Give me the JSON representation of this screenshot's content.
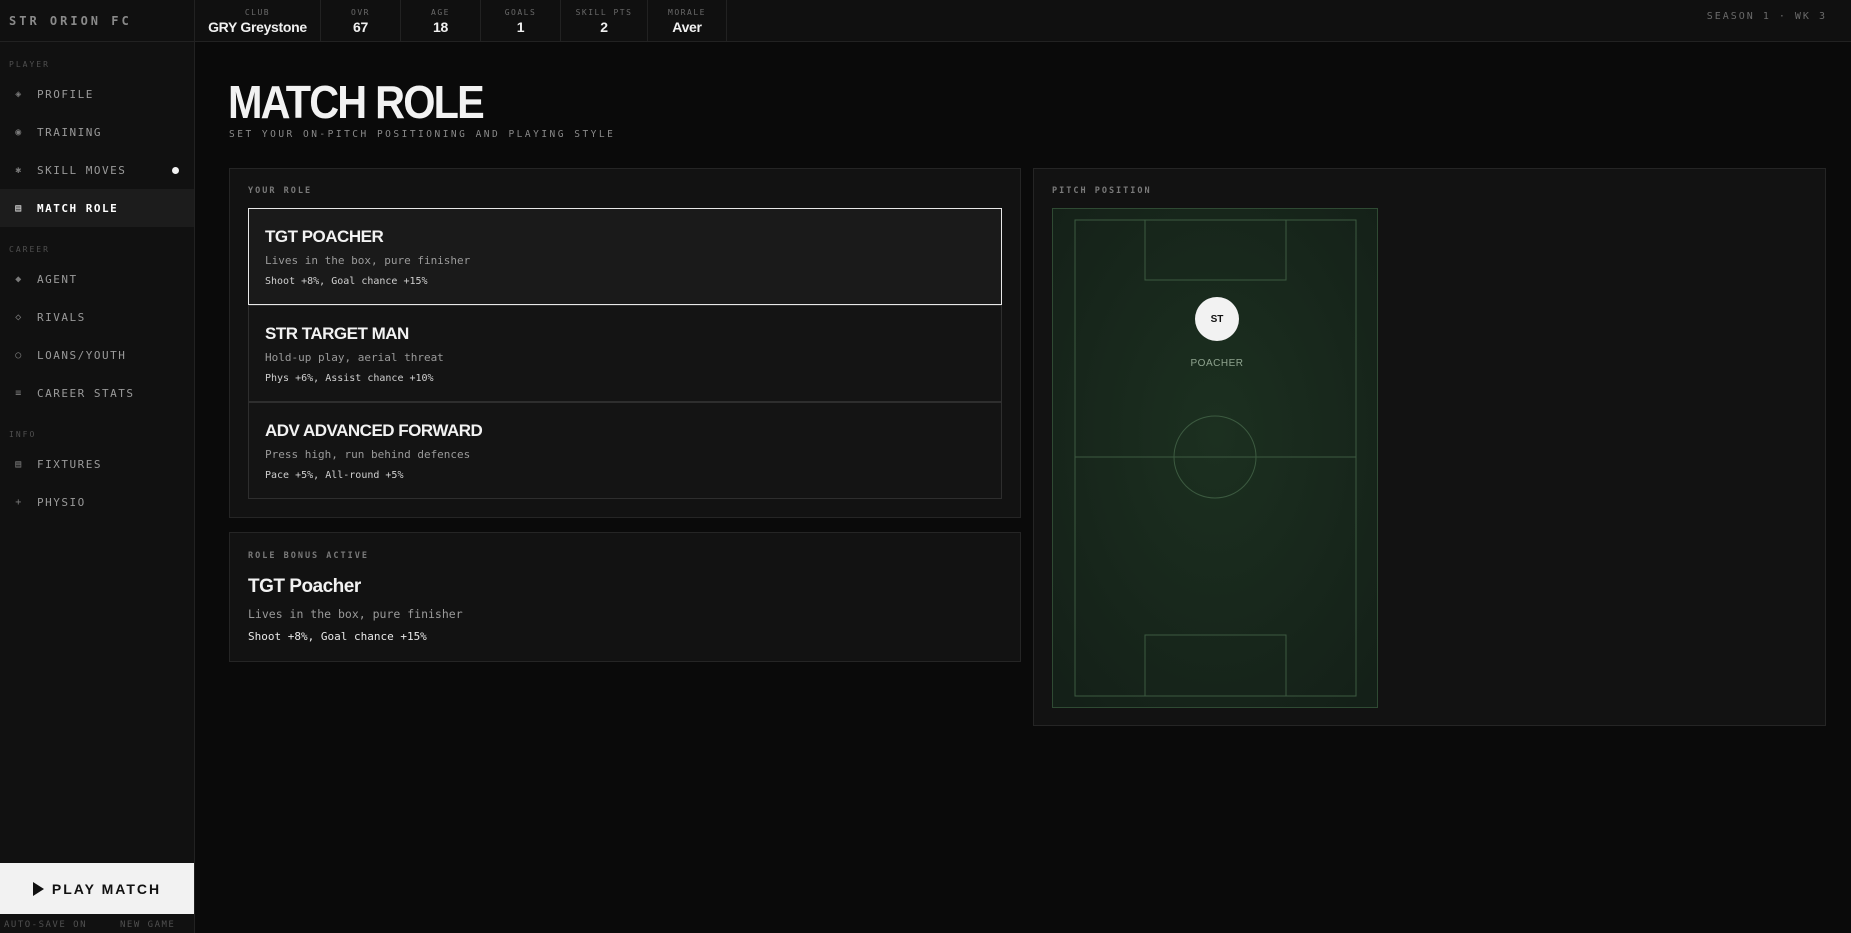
{
  "brand": "STR ORION FC",
  "season": "SEASON 1 · WK 3",
  "stats": [
    {
      "label": "CLUB",
      "value": "GRY Greystone"
    },
    {
      "label": "OVR",
      "value": "67"
    },
    {
      "label": "AGE",
      "value": "18"
    },
    {
      "label": "GOALS",
      "value": "1"
    },
    {
      "label": "SKILL PTS",
      "value": "2"
    },
    {
      "label": "MORALE",
      "value": "Aver"
    }
  ],
  "sidebar": {
    "sections": [
      "PLAYER",
      "CAREER",
      "INFO"
    ],
    "items": [
      {
        "icon": "◈",
        "icon_name": "profile-icon",
        "label": "PROFILE"
      },
      {
        "icon": "◉",
        "icon_name": "training-icon",
        "label": "TRAINING"
      },
      {
        "icon": "✱",
        "icon_name": "skill-moves-icon",
        "label": "SKILL MOVES"
      },
      {
        "icon": "▤",
        "icon_name": "match-role-icon",
        "label": "MATCH ROLE"
      },
      {
        "icon": "◆",
        "icon_name": "agent-icon",
        "label": "AGENT"
      },
      {
        "icon": "◇",
        "icon_name": "rivals-icon",
        "label": "RIVALS"
      },
      {
        "icon": "○",
        "icon_name": "loans-youth-icon",
        "label": "LOANS/YOUTH"
      },
      {
        "icon": "≡",
        "icon_name": "career-stats-icon",
        "label": "CAREER STATS"
      },
      {
        "icon": "▤",
        "icon_name": "fixtures-icon",
        "label": "FIXTURES"
      },
      {
        "icon": "+",
        "icon_name": "physio-icon",
        "label": "PHYSIO"
      }
    ],
    "play_button": "PLAY MATCH",
    "autosave": "AUTO-SAVE ON",
    "new_game": "NEW GAME"
  },
  "page": {
    "title": "MATCH ROLE",
    "subtitle": "SET YOUR ON-PITCH POSITIONING AND PLAYING STYLE"
  },
  "roles_panel": {
    "label": "YOUR ROLE",
    "roles": [
      {
        "name": "TGT POACHER",
        "desc": "Lives in the box, pure finisher",
        "bonus": "Shoot +8%, Goal chance +15%",
        "selected": true
      },
      {
        "name": "STR TARGET MAN",
        "desc": "Hold-up play, aerial threat",
        "bonus": "Phys +6%, Assist chance +10%",
        "selected": false
      },
      {
        "name": "ADV ADVANCED FORWARD",
        "desc": "Press high, run behind defences",
        "bonus": "Pace +5%, All-round +5%",
        "selected": false
      }
    ]
  },
  "bonus_panel": {
    "label": "ROLE BONUS ACTIVE",
    "name": "TGT Poacher",
    "desc": "Lives in the box, pure finisher",
    "bonus": "Shoot +8%, Goal chance +15%"
  },
  "pitch_panel": {
    "label": "PITCH POSITION",
    "marker": "ST",
    "marker_label": "POACHER"
  },
  "colors": {
    "background": "#0a0a0a",
    "panel": "#121212",
    "pitch": "#16241a",
    "accent": "#f2f2f2"
  }
}
